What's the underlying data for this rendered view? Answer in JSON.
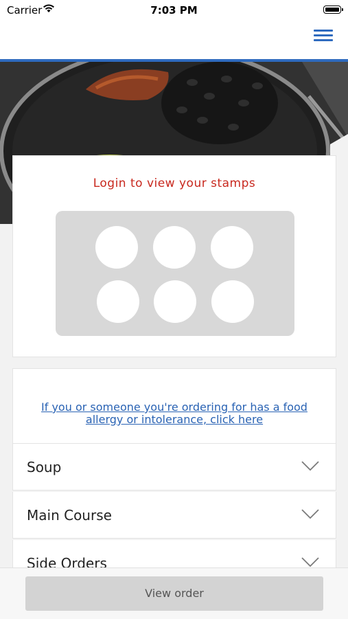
{
  "status_bar": {
    "carrier": "Carrier",
    "time": "7:03 PM"
  },
  "nav": {
    "menu_icon": "hamburger-menu-icon",
    "accent_color": "#2f6bbf"
  },
  "hero": {
    "image": "plate-of-food-photo"
  },
  "stamps": {
    "title": "Login to view your stamps",
    "slot_count": 6,
    "title_color": "#c8281e"
  },
  "allergy": {
    "link_text": "If you or someone you're ordering for has a food allergy or intolerance, click here"
  },
  "menu_sections": [
    {
      "label": "Soup",
      "icon": "chevron-down-icon"
    },
    {
      "label": "Main Course",
      "icon": "chevron-down-icon"
    },
    {
      "label": "Side Orders",
      "icon": "chevron-down-icon"
    }
  ],
  "footer": {
    "view_order_label": "View order"
  }
}
